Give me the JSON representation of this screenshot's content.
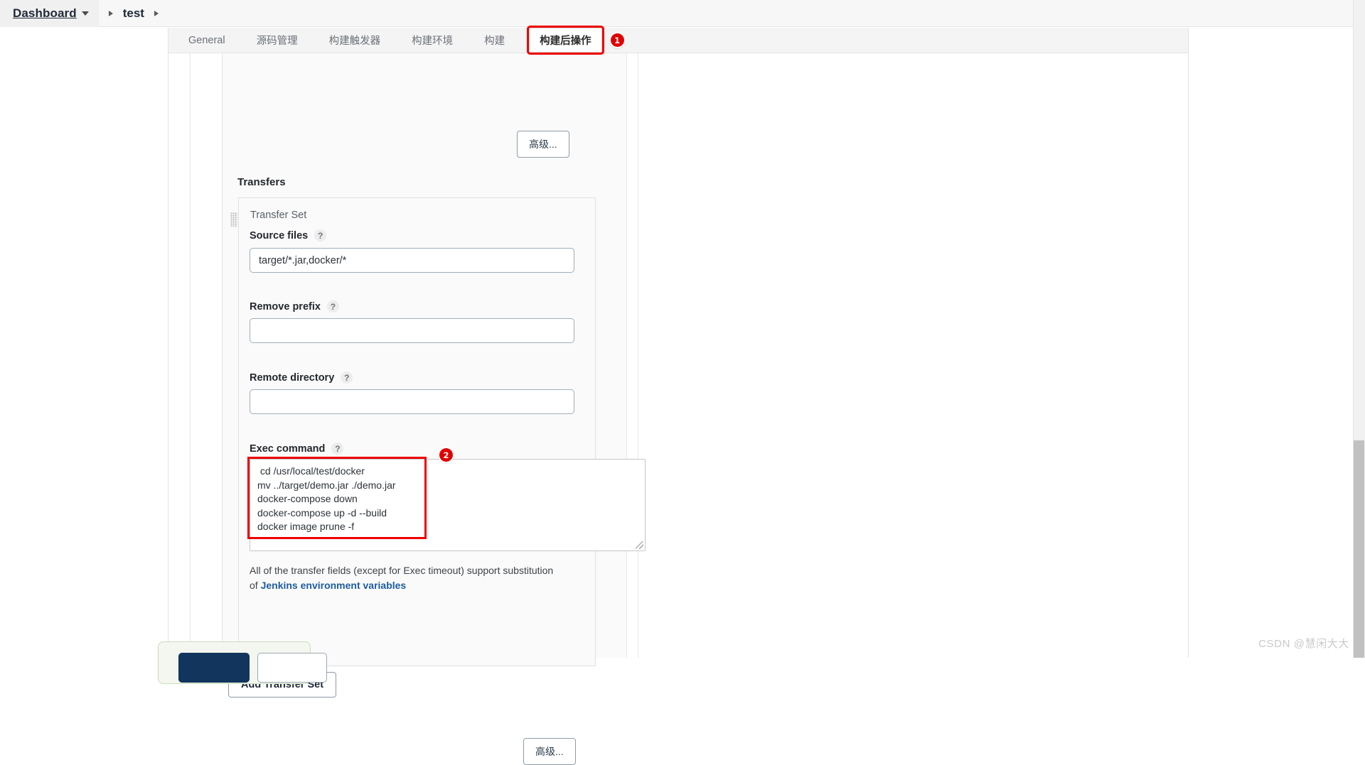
{
  "breadcrumb": {
    "dashboard_label": "Dashboard",
    "job_label": "test"
  },
  "tabs": [
    {
      "label": "General",
      "active": false
    },
    {
      "label": "源码管理",
      "active": false
    },
    {
      "label": "构建触发器",
      "active": false
    },
    {
      "label": "构建环境",
      "active": false
    },
    {
      "label": "构建",
      "active": false
    },
    {
      "label": "构建后操作",
      "active": true
    }
  ],
  "annotations": {
    "marker_one": "1",
    "marker_two": "2",
    "highlight_color": "#ee0000"
  },
  "buttons": {
    "advanced_top": "高级...",
    "advanced_bottom": "高级...",
    "add_transfer_set": "Add Transfer Set"
  },
  "transfers": {
    "section_title": "Transfers",
    "set_label": "Transfer Set",
    "help_glyph": "?",
    "fields": [
      {
        "label": "Source files",
        "value": "target/*.jar,docker/*",
        "placeholder": ""
      },
      {
        "label": "Remove prefix",
        "value": "",
        "placeholder": ""
      },
      {
        "label": "Remote directory",
        "value": "",
        "placeholder": ""
      }
    ],
    "exec_command": {
      "label": "Exec command",
      "value": " cd /usr/local/test/docker\nmv ../target/demo.jar ./demo.jar\ndocker-compose down\ndocker-compose up -d --build\ndocker image prune -f"
    },
    "hint": {
      "text_before": "All of the transfer fields (except for Exec timeout) support substitution of ",
      "link_text": "Jenkins environment variables"
    }
  },
  "watermark": "CSDN @慧闲大大"
}
